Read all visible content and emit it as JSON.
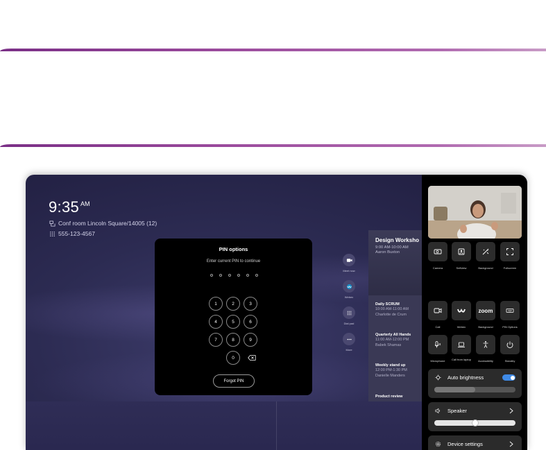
{
  "clock": {
    "time": "9:35",
    "ampm": "AM"
  },
  "room": {
    "name": "Conf room Lincoln Square/14005 (12)",
    "phone": "555-123-4567"
  },
  "pin_dialog": {
    "title": "PIN options",
    "subtitle": "Enter current PIN to continue",
    "keys": [
      "1",
      "2",
      "3",
      "4",
      "5",
      "6",
      "7",
      "8",
      "9",
      "0"
    ],
    "forgot_label": "Forgot PIN"
  },
  "quick_actions": [
    {
      "label": "Meet now",
      "icon": "camera-icon"
    },
    {
      "label": "Webex",
      "icon": "webex-icon"
    },
    {
      "label": "Dial pad",
      "icon": "dialpad-icon"
    },
    {
      "label": "More",
      "icon": "more-icon"
    }
  ],
  "meetings": {
    "featured": {
      "title": "Design Worksho",
      "time": "9:00 AM-10:00 AM",
      "host": "Aaron Buxton"
    },
    "items": [
      {
        "title": "Daily SCRUM",
        "time": "10:00 AM-11:00 AM",
        "host": "Charlotte de Crum"
      },
      {
        "title": "Quarterly All Hands",
        "time": "11:00 AM-12:00 PM",
        "host": "Babek Shamas"
      },
      {
        "title": "Weekly stand up",
        "time": "12:00 PM-1:30 PM",
        "host": "Danielle Manders"
      },
      {
        "title": "Product review",
        "time": "",
        "host": ""
      }
    ]
  },
  "panel": {
    "row1": [
      {
        "label": "Camera",
        "icon": "camera-control-icon"
      },
      {
        "label": "Selfview",
        "icon": "selfview-icon"
      },
      {
        "label": "Background",
        "icon": "background-icon"
      },
      {
        "label": "Fullscreen",
        "icon": "fullscreen-icon"
      }
    ],
    "row2": [
      {
        "label": "Call",
        "icon": "call-icon"
      },
      {
        "label": "Webex",
        "icon": "webex-icon"
      },
      {
        "label": "Background",
        "icon": "zoom-icon",
        "text": "zoom"
      },
      {
        "label": "PIN Options",
        "icon": "keyboard-icon"
      }
    ],
    "row3": [
      {
        "label": "Microphone",
        "icon": "microphone-icon"
      },
      {
        "label": "Call from laptop",
        "icon": "laptop-icon"
      },
      {
        "label": "Accessibility",
        "icon": "accessibility-icon"
      },
      {
        "label": "Standby",
        "icon": "power-icon"
      }
    ],
    "brightness": {
      "label": "Auto brightness",
      "enabled": true,
      "level": 0.5
    },
    "speaker": {
      "label": "Speaker",
      "level": 0.5
    },
    "settings": {
      "label": "Device settings"
    }
  },
  "colors": {
    "accent": "#3f8ae6",
    "deco_line": "#9a4a9c",
    "screen_bg": "#2c2b52"
  }
}
